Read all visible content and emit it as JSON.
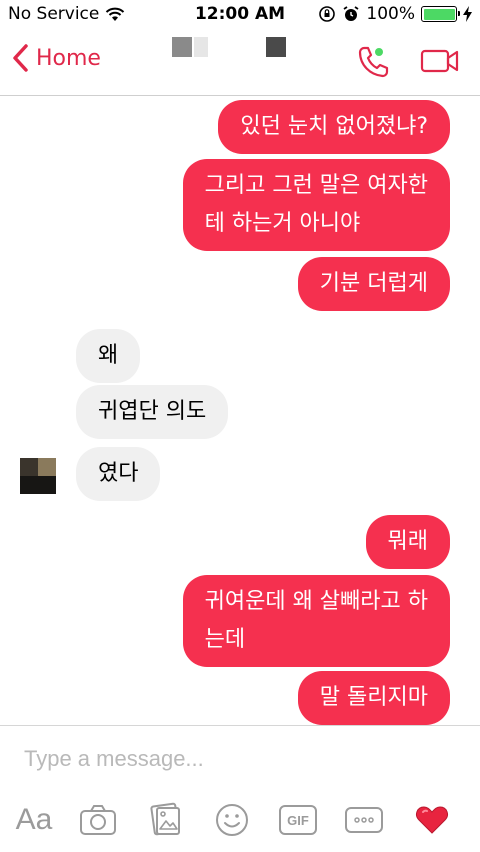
{
  "status_bar": {
    "carrier": "No Service",
    "time": "12:00 AM",
    "battery": "100%",
    "battery_level": 1.0
  },
  "nav": {
    "back_label": "Home",
    "icons": [
      "back-chevron-icon",
      "phone-call-icon",
      "video-call-icon"
    ],
    "accent_color": "#e0284a",
    "online_dot_color": "#4cd964"
  },
  "messages": [
    {
      "direction": "outgoing",
      "text": "있던 눈치 없어졌냐?"
    },
    {
      "direction": "outgoing",
      "text": "그리고 그런 말은 여자한\n테 하는거 아니야"
    },
    {
      "direction": "outgoing",
      "text": "기분 더럽게"
    },
    {
      "direction": "incoming",
      "text": "왜"
    },
    {
      "direction": "incoming",
      "text": "귀엽단 의도"
    },
    {
      "direction": "incoming",
      "text": "였다"
    },
    {
      "direction": "outgoing",
      "text": "뭐래"
    },
    {
      "direction": "outgoing",
      "text": "귀여운데 왜 살빼라고 하\n는데"
    },
    {
      "direction": "outgoing",
      "text": "말 돌리지마"
    }
  ],
  "colors": {
    "outgoing_bubble": "#f5304f",
    "incoming_bubble": "#f0f0f0"
  },
  "composer": {
    "placeholder": "Type a message...",
    "aa_label": "Aa",
    "gif_label": "GIF",
    "tools": [
      "text-style-icon",
      "camera-icon",
      "photo-gallery-icon",
      "emoji-icon",
      "gif-icon",
      "more-icon",
      "heart-icon"
    ]
  }
}
